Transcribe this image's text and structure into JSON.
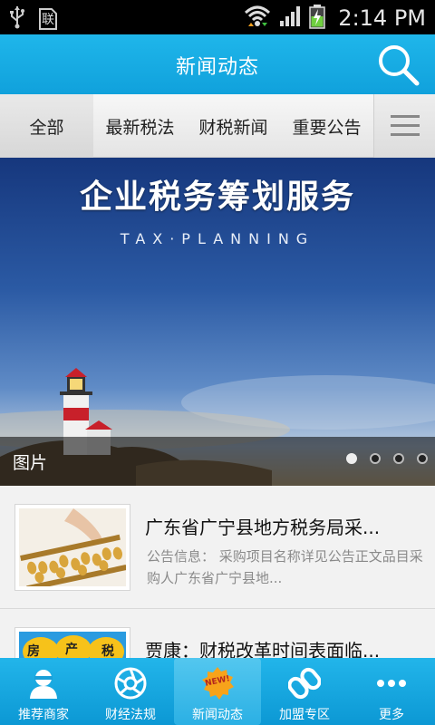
{
  "status_bar": {
    "time": "2:14 PM",
    "sim_label": "联",
    "icons": [
      "usb-icon",
      "sim-icon",
      "wifi-icon",
      "signal-icon",
      "battery-charging-icon"
    ]
  },
  "header": {
    "title": "新闻动态",
    "search_icon": "search-icon"
  },
  "tabs": [
    {
      "label": "全部",
      "active": true
    },
    {
      "label": "最新税法",
      "active": false
    },
    {
      "label": "财税新闻",
      "active": false
    },
    {
      "label": "重要公告",
      "active": false
    }
  ],
  "tabs_menu_icon": "menu-icon",
  "banner": {
    "title": "企业税务筹划服务",
    "subtitle": "TAX·PLANNING",
    "caption": "图片",
    "slide_count": 4,
    "active_slide": 1
  },
  "news": [
    {
      "title": "广东省广宁县地方税务局采...",
      "summary": "公告信息： 采购项目名称详见公告正文品目采购人广东省广宁县地...",
      "thumb": "abacus-image"
    },
    {
      "title": "贾康：财税改革时间表面临...",
      "summary": "",
      "thumb": "tax-property-image",
      "thumb_chars": [
        "房",
        "产",
        "税"
      ]
    }
  ],
  "bottom_nav": [
    {
      "label": "推荐商家",
      "icon": "person-icon",
      "active": false
    },
    {
      "label": "财经法规",
      "icon": "aperture-icon",
      "active": false
    },
    {
      "label": "新闻动态",
      "icon": "new-badge-icon",
      "active": true,
      "badge": "NEW!"
    },
    {
      "label": "加盟专区",
      "icon": "link-icon",
      "active": false
    },
    {
      "label": "更多",
      "icon": "more-icon",
      "active": false
    }
  ],
  "colors": {
    "primary": "#10a1dc",
    "tab_bg": "#e9e9e9",
    "text_dark": "#111111",
    "text_muted": "#8a8a8a"
  }
}
